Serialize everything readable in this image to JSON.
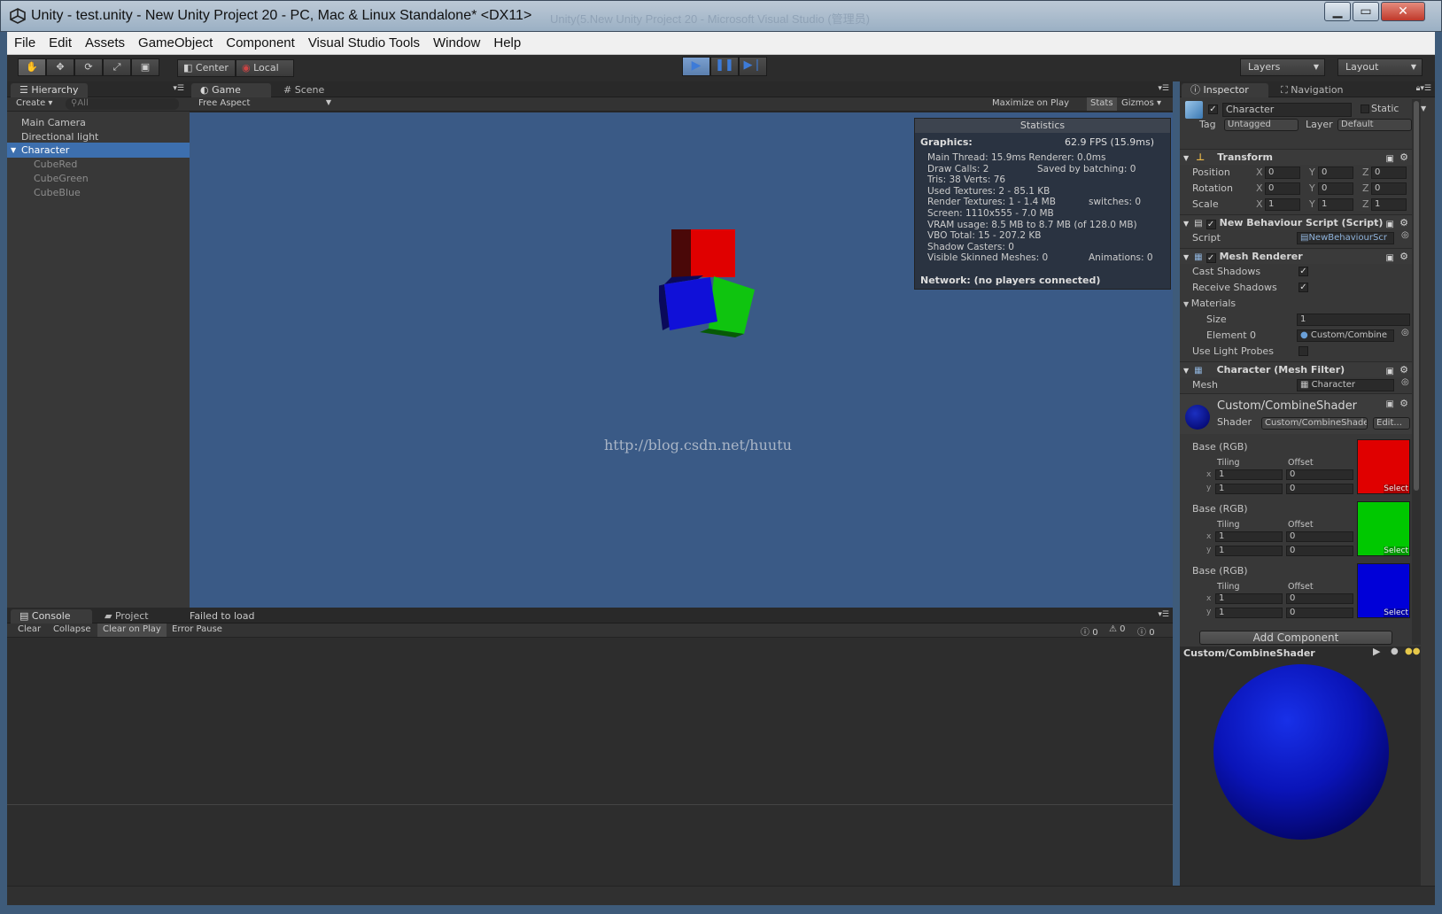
{
  "window": {
    "title": "Unity - test.unity - New Unity Project 20 - PC, Mac & Linux Standalone* <DX11>",
    "ghost_title": "Unity(5.New Unity Project 20 - Microsoft Visual Studio (管理员)",
    "minimize": "▁",
    "maximize": "▭",
    "close": "✕"
  },
  "menu": [
    "File",
    "Edit",
    "Assets",
    "GameObject",
    "Component",
    "Visual Studio Tools",
    "Window",
    "Help"
  ],
  "toolbar": {
    "pivot": "Center",
    "space": "Local",
    "layers": "Layers",
    "layout": "Layout"
  },
  "hierarchy": {
    "tab": "Hierarchy",
    "create": "Create",
    "search_placeholder": "All",
    "items": [
      "Main Camera",
      "Directional light",
      "Character",
      "CubeRed",
      "CubeGreen",
      "CubeBlue"
    ]
  },
  "game": {
    "tab_game": "Game",
    "tab_scene": "Scene",
    "aspect": "Free Aspect",
    "maximize": "Maximize on Play",
    "stats": "Stats",
    "gizmos": "Gizmos",
    "watermark": "http://blog.csdn.net/huutu"
  },
  "stats": {
    "title": "Statistics",
    "graphics": "Graphics:",
    "fps": "62.9 FPS (15.9ms)",
    "lines": [
      [
        "Main Thread: 15.9ms  Renderer: 0.0ms",
        ""
      ],
      [
        "Draw Calls: 2",
        "Saved by batching: 0"
      ],
      [
        "Tris: 38   Verts: 76",
        ""
      ],
      [
        "Used Textures: 2 - 85.1 KB",
        ""
      ],
      [
        "Render Textures: 1 - 1.4 MB",
        "switches: 0"
      ],
      [
        "Screen: 1110x555 - 7.0 MB",
        ""
      ],
      [
        "VRAM usage: 8.5 MB to 8.7 MB (of 128.0 MB)",
        ""
      ],
      [
        "VBO Total: 15 - 207.2 KB",
        ""
      ],
      [
        "Shadow Casters: 0",
        ""
      ],
      [
        "Visible Skinned Meshes: 0",
        "Animations: 0"
      ]
    ],
    "network": "Network: (no players connected)"
  },
  "console": {
    "tab_console": "Console",
    "tab_project": "Project",
    "status": "Failed to load",
    "buttons": [
      "Clear",
      "Collapse",
      "Clear on Play",
      "Error Pause"
    ],
    "counts": [
      "0",
      "0",
      "0"
    ]
  },
  "inspector": {
    "tab_inspector": "Inspector",
    "tab_navigation": "Navigation",
    "object_name": "Character",
    "static": "Static",
    "tag_label": "Tag",
    "tag": "Untagged",
    "layer_label": "Layer",
    "layer": "Default",
    "transform": {
      "title": "Transform",
      "rows": [
        {
          "label": "Position",
          "x": "0",
          "y": "0",
          "z": "0"
        },
        {
          "label": "Rotation",
          "x": "0",
          "y": "0",
          "z": "0"
        },
        {
          "label": "Scale",
          "x": "1",
          "y": "1",
          "z": "1"
        }
      ]
    },
    "script_comp": {
      "title": "New Behaviour Script (Script)",
      "label": "Script",
      "value": "NewBehaviourScr"
    },
    "mesh_renderer": {
      "title": "Mesh Renderer",
      "cast": "Cast Shadows",
      "receive": "Receive Shadows",
      "materials": "Materials",
      "size_label": "Size",
      "size": "1",
      "element_label": "Element 0",
      "element": "Custom/Combine",
      "probes": "Use Light Probes"
    },
    "mesh_filter": {
      "title": "Character (Mesh Filter)",
      "label": "Mesh",
      "value": "Character"
    },
    "material": {
      "name": "Custom/CombineShader",
      "shader_label": "Shader",
      "shader": "Custom/CombineShader",
      "edit": "Edit...",
      "textures": [
        {
          "label": "Base (RGB)",
          "color": "#e00000",
          "tx": "1",
          "ty": "1",
          "ox": "0",
          "oy": "0"
        },
        {
          "label": "Base (RGB)",
          "color": "#00c800",
          "tx": "1",
          "ty": "1",
          "ox": "0",
          "oy": "0"
        },
        {
          "label": "Base (RGB)",
          "color": "#0000d8",
          "tx": "1",
          "ty": "1",
          "ox": "0",
          "oy": "0"
        }
      ],
      "tiling": "Tiling",
      "offset": "Offset",
      "x": "x",
      "y": "y",
      "select": "Select"
    },
    "add_component": "Add Component",
    "preview_title": "Custom/CombineShader"
  }
}
